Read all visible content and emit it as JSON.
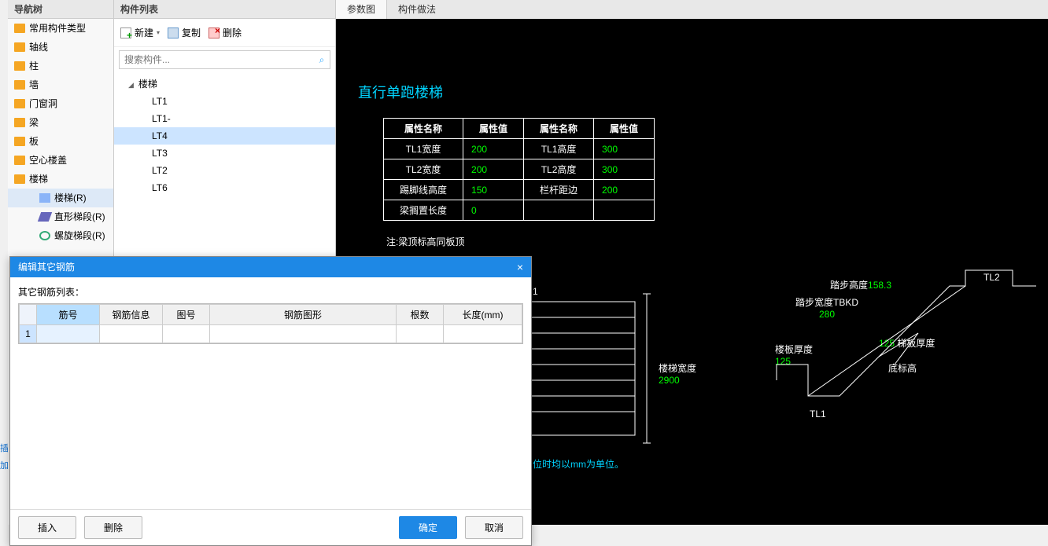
{
  "nav": {
    "title": "导航树",
    "items": [
      {
        "label": "常用构件类型"
      },
      {
        "label": "轴线"
      },
      {
        "label": "柱"
      },
      {
        "label": "墙"
      },
      {
        "label": "门窗洞"
      },
      {
        "label": "梁"
      },
      {
        "label": "板"
      },
      {
        "label": "空心楼盖"
      },
      {
        "label": "楼梯",
        "open": true
      }
    ],
    "sub": [
      {
        "label": "楼梯(R)",
        "icon": "stair",
        "selected": true
      },
      {
        "label": "直形梯段(R)",
        "icon": "seg"
      },
      {
        "label": "螺旋梯段(R)",
        "icon": "spiral"
      }
    ]
  },
  "list": {
    "title": "构件列表",
    "toolbar": {
      "new": "新建",
      "copy": "复制",
      "del": "删除"
    },
    "search_placeholder": "搜索构件...",
    "root": "楼梯",
    "leaves": [
      "LT1",
      "LT1-",
      "LT4",
      "LT3",
      "LT2",
      "LT6"
    ],
    "selected": "LT4"
  },
  "right": {
    "tabs": {
      "a": "参数图",
      "b": "构件做法"
    },
    "title": "直行单跑楼梯",
    "headers": {
      "name": "属性名称",
      "val": "属性值"
    },
    "rows": [
      {
        "n1": "TL1宽度",
        "v1": "200",
        "n2": "TL1高度",
        "v2": "300"
      },
      {
        "n1": "TL2宽度",
        "v1": "200",
        "n2": "TL2高度",
        "v2": "300"
      },
      {
        "n1": "踢脚线高度",
        "v1": "150",
        "n2": "栏杆距边",
        "v2": "200"
      },
      {
        "n1": "梁搁置长度",
        "v1": "0",
        "n2": "",
        "v2": ""
      }
    ],
    "note": "注:梁顶标高同板顶",
    "bottom_note": "位时均以mm为单位。",
    "schem": {
      "tl2": "TL2",
      "step_h": "踏步高度",
      "step_h_v": "158.3",
      "step_w": "踏步宽度TBKD",
      "step_w_v": "280",
      "slab_t": "梯板厚度",
      "slab_t_v": "125",
      "floor_t": "楼板厚度",
      "floor_t_v": "125",
      "bottom": "底标高",
      "tl1": "TL1",
      "stair_w": "楼梯宽度",
      "stair_w_v": "2900",
      "one": "1"
    }
  },
  "modal": {
    "title": "编辑其它钢筋",
    "label": "其它钢筋列表：",
    "cols": {
      "c1": "筋号",
      "c2": "钢筋信息",
      "c3": "图号",
      "c4": "钢筋图形",
      "c5": "根数",
      "c6": "长度(mm)"
    },
    "rownum": "1",
    "btns": {
      "insert": "插入",
      "delete": "删除",
      "ok": "确定",
      "cancel": "取消"
    }
  },
  "gutter": {
    "a": "插",
    "b": "加"
  }
}
